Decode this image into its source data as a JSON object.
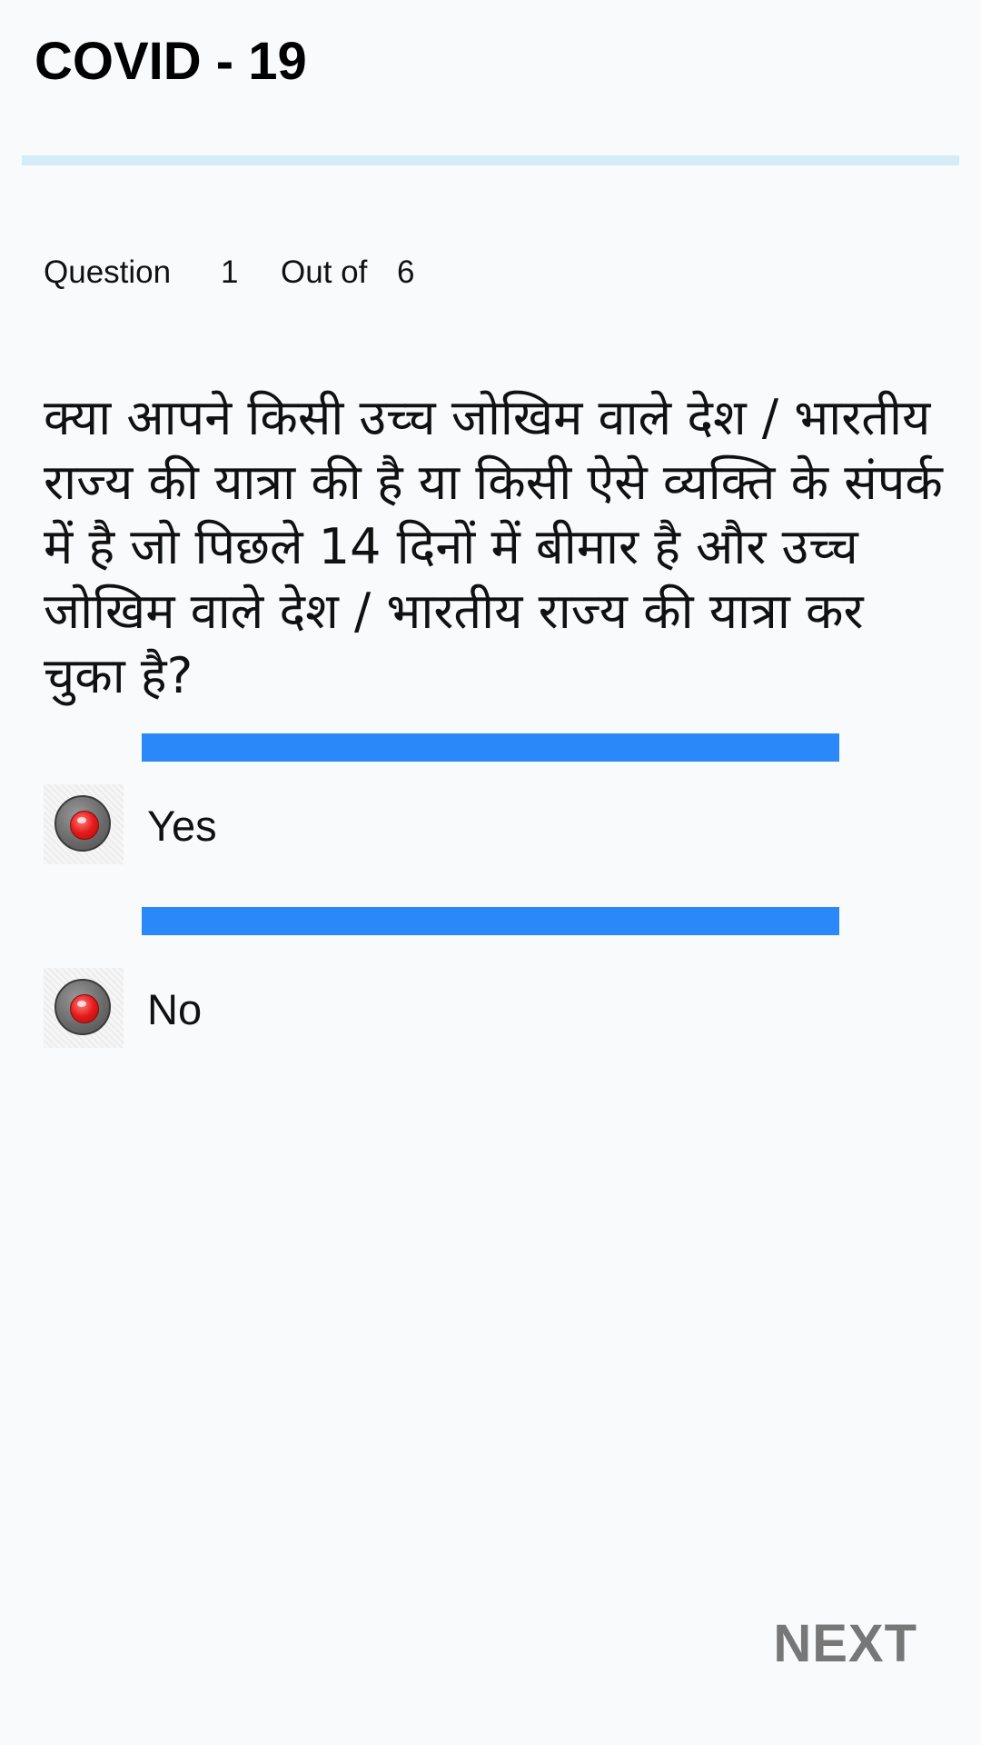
{
  "app": {
    "title": "COVID - 19"
  },
  "progress": {
    "fraction": 0.0
  },
  "question_counter": {
    "question_word": "Question",
    "current": "1",
    "out_of_word": "Out of",
    "total": "6"
  },
  "question": {
    "text": "क्या आपने किसी उच्च जोखिम वाले देश / भारतीय राज्य की यात्रा की है या किसी ऐसे व्यक्ति के संपर्क में है जो पिछले 14 दिनों में बीमार है और उच्च जोखिम वाले देश / भारतीय राज्य की यात्रा कर चुका है?"
  },
  "options": [
    {
      "label": "Yes",
      "icon": "red-radio-icon"
    },
    {
      "label": "No",
      "icon": "red-radio-icon"
    }
  ],
  "actions": {
    "next_label": "NEXT"
  },
  "colors": {
    "accent_bar": "#2b88f9",
    "progress_track": "#d4ebf8",
    "next_text": "#777777",
    "radio_center": "#e31a1a",
    "background": "#f9fafb"
  }
}
